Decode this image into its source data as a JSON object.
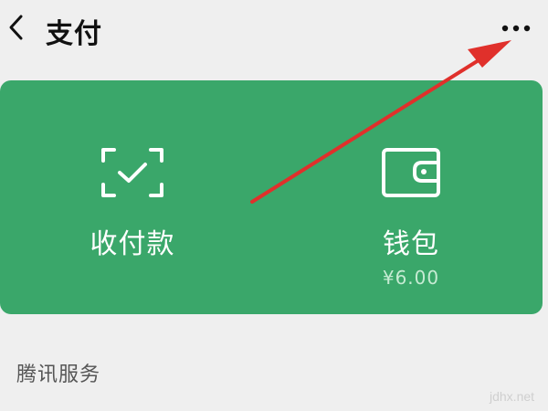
{
  "header": {
    "title": "支付",
    "back_icon": "chevron-left-icon",
    "more_icon": "more-dots-icon"
  },
  "card": {
    "background_color": "#3aa76a",
    "receive_pay": {
      "label": "收付款",
      "icon": "scan-check-icon"
    },
    "wallet": {
      "label": "钱包",
      "balance": "¥6.00",
      "icon": "wallet-icon"
    }
  },
  "section": {
    "title": "腾讯服务"
  },
  "watermark": "jdhx.net",
  "annotation": {
    "color": "#e0302b"
  }
}
